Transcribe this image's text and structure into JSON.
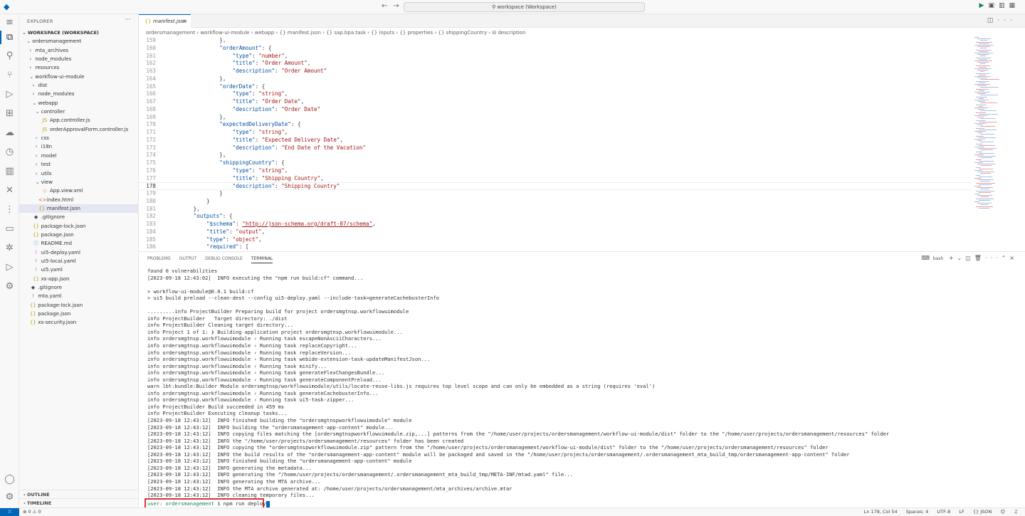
{
  "titlebar": {
    "search": "workspace (Workspace)"
  },
  "sidebar": {
    "title": "EXPLORER",
    "tree": [
      {
        "label": "WORKSPACE (WORKSPACE)",
        "depth": 0,
        "twisty": "open",
        "icon": "",
        "bold": true
      },
      {
        "label": "ordersmanagement",
        "depth": 1,
        "twisty": "open",
        "icon": ""
      },
      {
        "label": "mta_archives",
        "depth": 2,
        "twisty": "closed",
        "icon": ""
      },
      {
        "label": "node_modules",
        "depth": 2,
        "twisty": "closed",
        "icon": ""
      },
      {
        "label": "resources",
        "depth": 2,
        "twisty": "closed",
        "icon": ""
      },
      {
        "label": "workflow-ui-module",
        "depth": 2,
        "twisty": "open",
        "icon": ""
      },
      {
        "label": "dist",
        "depth": 3,
        "twisty": "closed",
        "icon": ""
      },
      {
        "label": "node_modules",
        "depth": 3,
        "twisty": "closed",
        "icon": ""
      },
      {
        "label": "webapp",
        "depth": 3,
        "twisty": "open",
        "icon": ""
      },
      {
        "label": "controller",
        "depth": 4,
        "twisty": "open",
        "icon": ""
      },
      {
        "label": "App.controller.js",
        "depth": 5,
        "twisty": "",
        "icon": "js"
      },
      {
        "label": "orderApprovalForm.controller.js",
        "depth": 5,
        "twisty": "",
        "icon": "js"
      },
      {
        "label": "css",
        "depth": 4,
        "twisty": "closed",
        "icon": ""
      },
      {
        "label": "i18n",
        "depth": 4,
        "twisty": "closed",
        "icon": ""
      },
      {
        "label": "model",
        "depth": 4,
        "twisty": "closed",
        "icon": ""
      },
      {
        "label": "test",
        "depth": 4,
        "twisty": "closed",
        "icon": ""
      },
      {
        "label": "utils",
        "depth": 4,
        "twisty": "closed",
        "icon": ""
      },
      {
        "label": "view",
        "depth": 4,
        "twisty": "open",
        "icon": ""
      },
      {
        "label": "App.view.xml",
        "depth": 5,
        "twisty": "",
        "icon": "xml"
      },
      {
        "label": "index.html",
        "depth": 4,
        "twisty": "",
        "icon": "html"
      },
      {
        "label": "manifest.json",
        "depth": 4,
        "twisty": "",
        "icon": "json",
        "selected": true
      },
      {
        "label": ".gitignore",
        "depth": 3,
        "twisty": "",
        "icon": "git"
      },
      {
        "label": "package-lock.json",
        "depth": 3,
        "twisty": "",
        "icon": "json"
      },
      {
        "label": "package.json",
        "depth": 3,
        "twisty": "",
        "icon": "json"
      },
      {
        "label": "README.md",
        "depth": 3,
        "twisty": "",
        "icon": "md"
      },
      {
        "label": "ui5-deploy.yaml",
        "depth": 3,
        "twisty": "",
        "icon": "yaml"
      },
      {
        "label": "ui5-local.yaml",
        "depth": 3,
        "twisty": "",
        "icon": "yaml"
      },
      {
        "label": "ui5.yaml",
        "depth": 3,
        "twisty": "",
        "icon": "yaml"
      },
      {
        "label": "xs-app.json",
        "depth": 3,
        "twisty": "",
        "icon": "json"
      },
      {
        "label": ".gitignore",
        "depth": 2,
        "twisty": "",
        "icon": "git"
      },
      {
        "label": "mta.yaml",
        "depth": 2,
        "twisty": "",
        "icon": "yaml"
      },
      {
        "label": "package-lock.json",
        "depth": 2,
        "twisty": "",
        "icon": "json"
      },
      {
        "label": "package.json",
        "depth": 2,
        "twisty": "",
        "icon": "json"
      },
      {
        "label": "xs-security.json",
        "depth": 2,
        "twisty": "",
        "icon": "json"
      }
    ],
    "outline": "OUTLINE",
    "timeline": "TIMELINE"
  },
  "icons": {
    "json": "{}",
    "js": "JS",
    "xml": "◇",
    "html": "<>",
    "yaml": "!",
    "md": "ⓘ",
    "git": "◆"
  },
  "editor": {
    "tab": "manifest.json",
    "breadcrumb": "ordersmanagement › workflow-ui-module › webapp › {} manifest.json › {} sap.bpa.task › {} inputs › {} properties › {} shippingCountry › ⊟ description",
    "current_line": 178,
    "lines": [
      {
        "n": 159,
        "indent": 16,
        "parts": [
          [
            "p",
            "},"
          ]
        ]
      },
      {
        "n": 160,
        "indent": 16,
        "parts": [
          [
            "k",
            "\"orderAmount\""
          ],
          [
            "p",
            ": {"
          ]
        ]
      },
      {
        "n": 161,
        "indent": 20,
        "parts": [
          [
            "k",
            "\"type\""
          ],
          [
            "p",
            ": "
          ],
          [
            "s",
            "\"number\""
          ],
          [
            "p",
            ","
          ]
        ]
      },
      {
        "n": 162,
        "indent": 20,
        "parts": [
          [
            "k",
            "\"title\""
          ],
          [
            "p",
            ": "
          ],
          [
            "s",
            "\"Order Amount\""
          ],
          [
            "p",
            ","
          ]
        ]
      },
      {
        "n": 163,
        "indent": 20,
        "parts": [
          [
            "k",
            "\"description\""
          ],
          [
            "p",
            ": "
          ],
          [
            "s",
            "\"Order Amount\""
          ]
        ]
      },
      {
        "n": 164,
        "indent": 16,
        "parts": [
          [
            "p",
            "},"
          ]
        ]
      },
      {
        "n": 165,
        "indent": 16,
        "parts": [
          [
            "k",
            "\"orderDate\""
          ],
          [
            "p",
            ": {"
          ]
        ]
      },
      {
        "n": 166,
        "indent": 20,
        "parts": [
          [
            "k",
            "\"type\""
          ],
          [
            "p",
            ": "
          ],
          [
            "s",
            "\"string\""
          ],
          [
            "p",
            ","
          ]
        ]
      },
      {
        "n": 167,
        "indent": 20,
        "parts": [
          [
            "k",
            "\"title\""
          ],
          [
            "p",
            ": "
          ],
          [
            "s",
            "\"Order Date\""
          ],
          [
            "p",
            ","
          ]
        ]
      },
      {
        "n": 168,
        "indent": 20,
        "parts": [
          [
            "k",
            "\"description\""
          ],
          [
            "p",
            ": "
          ],
          [
            "s",
            "\"Order Date\""
          ]
        ]
      },
      {
        "n": 169,
        "indent": 16,
        "parts": [
          [
            "p",
            "},"
          ]
        ]
      },
      {
        "n": 170,
        "indent": 16,
        "parts": [
          [
            "k",
            "\"expectedDeliveryDate\""
          ],
          [
            "p",
            ": {"
          ]
        ]
      },
      {
        "n": 171,
        "indent": 20,
        "parts": [
          [
            "k",
            "\"type\""
          ],
          [
            "p",
            ": "
          ],
          [
            "s",
            "\"string\""
          ],
          [
            "p",
            ","
          ]
        ]
      },
      {
        "n": 172,
        "indent": 20,
        "parts": [
          [
            "k",
            "\"title\""
          ],
          [
            "p",
            ": "
          ],
          [
            "s",
            "\"Expected Delivery Date\""
          ],
          [
            "p",
            ","
          ]
        ]
      },
      {
        "n": 173,
        "indent": 20,
        "parts": [
          [
            "k",
            "\"description\""
          ],
          [
            "p",
            ": "
          ],
          [
            "s",
            "\"End Date of the Vacation\""
          ]
        ]
      },
      {
        "n": 174,
        "indent": 16,
        "parts": [
          [
            "p",
            "},"
          ]
        ]
      },
      {
        "n": 175,
        "indent": 16,
        "parts": [
          [
            "k",
            "\"shippingCountry\""
          ],
          [
            "p",
            ": {"
          ]
        ]
      },
      {
        "n": 176,
        "indent": 20,
        "parts": [
          [
            "k",
            "\"type\""
          ],
          [
            "p",
            ": "
          ],
          [
            "s",
            "\"string\""
          ],
          [
            "p",
            ","
          ]
        ]
      },
      {
        "n": 177,
        "indent": 20,
        "parts": [
          [
            "k",
            "\"title\""
          ],
          [
            "p",
            ": "
          ],
          [
            "s",
            "\"Shipping Country\""
          ],
          [
            "p",
            ","
          ]
        ]
      },
      {
        "n": 178,
        "indent": 20,
        "parts": [
          [
            "k",
            "\"description\""
          ],
          [
            "p",
            ": "
          ],
          [
            "s",
            "\"Shipping Country\""
          ]
        ]
      },
      {
        "n": 179,
        "indent": 16,
        "parts": [
          [
            "p",
            "}"
          ]
        ]
      },
      {
        "n": 180,
        "indent": 12,
        "parts": [
          [
            "p",
            "}"
          ]
        ]
      },
      {
        "n": 181,
        "indent": 8,
        "parts": [
          [
            "p",
            "},"
          ]
        ]
      },
      {
        "n": 182,
        "indent": 8,
        "parts": [
          [
            "k",
            "\"outputs\""
          ],
          [
            "p",
            ": {"
          ]
        ]
      },
      {
        "n": 183,
        "indent": 12,
        "parts": [
          [
            "k",
            "\"$schema\""
          ],
          [
            "p",
            ": "
          ],
          [
            "u",
            "\"http://json-schema.org/draft-07/schema\""
          ],
          [
            "p",
            ","
          ]
        ]
      },
      {
        "n": 184,
        "indent": 12,
        "parts": [
          [
            "k",
            "\"title\""
          ],
          [
            "p",
            ": "
          ],
          [
            "s",
            "\"output\""
          ],
          [
            "p",
            ","
          ]
        ]
      },
      {
        "n": 185,
        "indent": 12,
        "parts": [
          [
            "k",
            "\"type\""
          ],
          [
            "p",
            ": "
          ],
          [
            "s",
            "\"object\""
          ],
          [
            "p",
            ","
          ]
        ]
      },
      {
        "n": 186,
        "indent": 12,
        "parts": [
          [
            "k",
            "\"required\""
          ],
          [
            "p",
            ": ["
          ]
        ]
      }
    ]
  },
  "panel": {
    "tabs": [
      "PROBLEMS",
      "OUTPUT",
      "DEBUG CONSOLE",
      "TERMINAL"
    ],
    "active_tab": "TERMINAL",
    "shell": "bash",
    "terminal_lines": [
      "found 0 vulnerabilities",
      "[2023-09-18 12:43:02]  INFO executing the \"npm run build:cf\" command...",
      "",
      "> workflow-ui-module@0.0.1 build:cf",
      "> ui5 build preload --clean-dest --config ui5-deploy.yaml --include-task=generateCachebusterInfo",
      "",
      ".........info ProjectBuilder Preparing build for project ordersmgtnsp.workflowuimodule",
      "info ProjectBuilder   Target directory: ./dist",
      "info ProjectBuilder Cleaning target directory...",
      "info Project 1 of 1: ❯ Building application project ordersmgtnsp.workflowuimodule...",
      "info ordersmgtnsp.workflowuimodule › Running task escapeNonAsciiCharacters...",
      "info ordersmgtnsp.workflowuimodule › Running task replaceCopyright...",
      "info ordersmgtnsp.workflowuimodule › Running task replaceVersion...",
      "info ordersmgtnsp.workflowuimodule › Running task webide-extension-task-updateManifestJson...",
      "info ordersmgtnsp.workflowuimodule › Running task minify...",
      "info ordersmgtnsp.workflowuimodule › Running task generateFlexChangesBundle...",
      "info ordersmgtnsp.workflowuimodule › Running task generateComponentPreload...",
      "warn lbt:bundle:Builder Module ordersmgtnsp/workflowuimodule/utils/locate-reuse-libs.js requires top level scope and can only be embedded as a string (requires 'eval')",
      "info ordersmgtnsp.workflowuimodule › Running task generateCachebusterInfo...",
      "info ordersmgtnsp.workflowuimodule › Running task ui5-task-zipper...",
      "info ProjectBuilder Build succeeded in 459 ms",
      "info ProjectBuilder Executing cleanup tasks...",
      "[2023-09-18 12:43:12]  INFO finished building the \"ordersmgtnspworkflowuimodule\" module",
      "[2023-09-18 12:43:12]  INFO building the \"ordersmanagement-app-content\" module...",
      "[2023-09-18 12:43:12]  INFO copying files matching the [ordersmgtnspworkflowuimodule.zip,...] patterns from the \"/home/user/projects/ordersmanagement/workflow-ui-module/dist\" folder to the \"/home/user/projects/ordersmanagement/resources\" folder",
      "[2023-09-18 12:43:12]  INFO the \"/home/user/projects/ordersmanagement/resources\" folder has been created",
      "[2023-09-18 12:43:12]  INFO copying the \"ordersmgtnspworkflowuimodule.zip\" pattern from the \"/home/user/projects/ordersmanagement/workflow-ui-module/dist\" folder to the \"/home/user/projects/ordersmanagement/resources\" folder",
      "[2023-09-18 12:43:12]  INFO the build results of the \"ordersmanagement-app-content\" module will be packaged and saved in the \"/home/user/projects/ordersmanagement/.ordersmanagement_mta_build_tmp/ordersmanagement-app-content\" folder",
      "[2023-09-18 12:43:12]  INFO finished building the \"ordersmanagement-app-content\" module",
      "[2023-09-18 12:43:12]  INFO generating the metadata...",
      "[2023-09-18 12:43:12]  INFO generating the \"/home/user/projects/ordersmanagement/.ordersmanagement_mta_build_tmp/META-INF/mtad.yaml\" file...",
      "[2023-09-18 12:43:12]  INFO generating the MTA archive...",
      "[2023-09-18 12:43:12]  INFO the MTA archive generated at: /home/user/projects/ordersmanagement/mta_archives/archive.mtar",
      "[2023-09-18 12:43:12]  INFO cleaning temporary files..."
    ],
    "prompt_user": "user: ordersmanagement $ ",
    "prompt_cmd": "npm run deploy"
  },
  "statusbar": {
    "problems": "⊗ 0 ⚠ 0",
    "position": "Ln 178, Col 54",
    "spaces": "Spaces: 4",
    "encoding": "UTF-8",
    "eol": "LF",
    "language": "{} JSON"
  },
  "colors": {
    "accent": "#0066b8",
    "highlight_box": "#d9343c",
    "json_key": "#0451a5",
    "json_string": "#a31515"
  }
}
